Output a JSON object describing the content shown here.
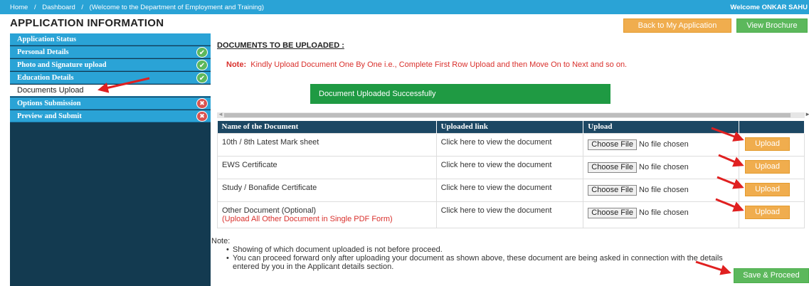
{
  "topbar": {
    "breadcrumbs": [
      "Home",
      "/",
      "Dashboard",
      "/",
      "(Welcome to the Department of Employment and Training)"
    ],
    "welcome": "Welcome ONKAR SAHU"
  },
  "page_title": "APPLICATION INFORMATION",
  "header_buttons": {
    "back": "Back to My Application",
    "brochure": "View Brochure"
  },
  "sidebar": {
    "items": [
      {
        "label": "Application Status",
        "status": ""
      },
      {
        "label": "Personal Details",
        "status": "✔"
      },
      {
        "label": "Photo and Signature upload",
        "status": "✔"
      },
      {
        "label": "Education Details",
        "status": "✔"
      },
      {
        "label": "Documents Upload",
        "status": ""
      },
      {
        "label": "Options Submission",
        "status": "✖"
      },
      {
        "label": "Preview and Submit",
        "status": "✖"
      }
    ]
  },
  "main": {
    "section_title": "DOCUMENTS TO BE UPLOADED :",
    "note_label": "Note:",
    "note_text": "Kindly Upload Document One By One i.e., Complete First Row Upload and then Move On to Next and so on.",
    "success_message": "Document Uploaded Successfully",
    "table": {
      "headers": [
        "Name of the Document",
        "Uploaded link",
        "Upload",
        ""
      ],
      "rows": [
        {
          "name": "10th / 8th Latest Mark sheet",
          "sub": "",
          "link": "Click here to view the document",
          "file_button": "Choose File",
          "file_status": "No file chosen",
          "upload": "Upload"
        },
        {
          "name": "EWS Certificate",
          "sub": "",
          "link": "Click here to view the document",
          "file_button": "Choose File",
          "file_status": "No file chosen",
          "upload": "Upload"
        },
        {
          "name": "Study / Bonafide Certificate",
          "sub": "",
          "link": "Click here to view the document",
          "file_button": "Choose File",
          "file_status": "No file chosen",
          "upload": "Upload"
        },
        {
          "name": "Other Document (Optional)",
          "sub": "(Upload All Other Document in Single PDF Form)",
          "link": "Click here to view the document",
          "file_button": "Choose File",
          "file_status": "No file chosen",
          "upload": "Upload"
        }
      ]
    },
    "bottom_note": {
      "label": "Note:",
      "items": [
        "Showing of which document uploaded is not before proceed.",
        "You can proceed forward only after uploading your document as shown above, these document are being asked in connection with the details",
        "entered by you in the Applicant details section."
      ]
    },
    "save_button": "Save & Proceed"
  },
  "colors": {
    "topbar": "#2aa3d6",
    "sidebar_bg": "#133a50",
    "table_header": "#1c4763",
    "success": "#1f9a43",
    "warning_button": "#f0ad4e",
    "green_button": "#5cb85c",
    "note_red": "#d9302c",
    "annotation_arrow": "#e02020"
  }
}
